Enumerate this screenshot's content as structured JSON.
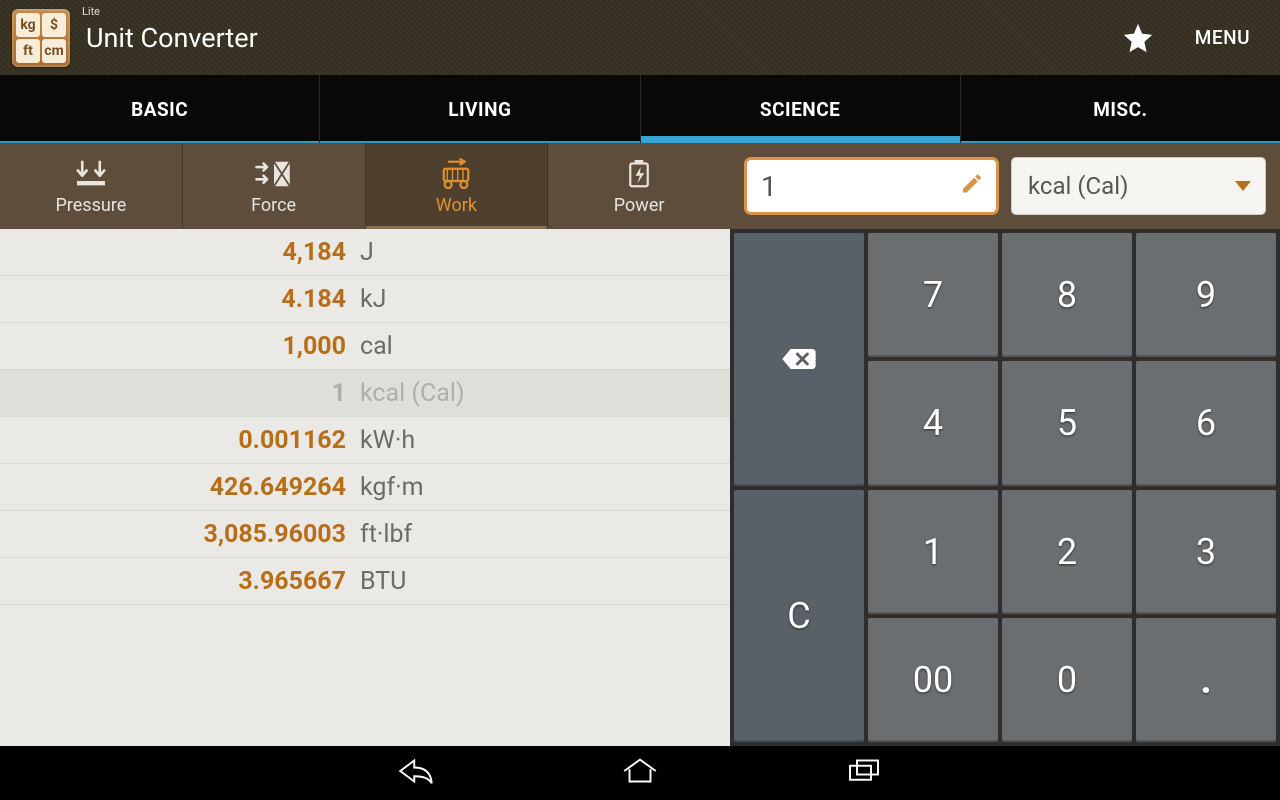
{
  "header": {
    "lite_badge": "Lite",
    "icon_tiles": [
      "kg",
      "$",
      "ft",
      "cm"
    ],
    "title": "Unit Converter",
    "menu_label": "MENU"
  },
  "tabs": [
    {
      "label": "BASIC",
      "active": false
    },
    {
      "label": "LIVING",
      "active": false
    },
    {
      "label": "SCIENCE",
      "active": true
    },
    {
      "label": "MISC.",
      "active": false
    }
  ],
  "categories": [
    {
      "name": "Pressure",
      "active": false
    },
    {
      "name": "Force",
      "active": false
    },
    {
      "name": "Work",
      "active": true
    },
    {
      "name": "Power",
      "active": false
    }
  ],
  "input": {
    "value": "1",
    "unit_selected": "kcal (Cal)"
  },
  "results": [
    {
      "value": "4,184",
      "unit": "J",
      "selected": false
    },
    {
      "value": "4.184",
      "unit": "kJ",
      "selected": false
    },
    {
      "value": "1,000",
      "unit": "cal",
      "selected": false
    },
    {
      "value": "1",
      "unit": "kcal (Cal)",
      "selected": true
    },
    {
      "value": "0.001162",
      "unit": "kW·h",
      "selected": false
    },
    {
      "value": "426.649264",
      "unit": "kgf·m",
      "selected": false
    },
    {
      "value": "3,085.96003",
      "unit": "ft·lbf",
      "selected": false
    },
    {
      "value": "3.965667",
      "unit": "BTU",
      "selected": false
    }
  ],
  "keypad": {
    "k7": "7",
    "k8": "8",
    "k9": "9",
    "k4": "4",
    "k5": "5",
    "k6": "6",
    "k1": "1",
    "k2": "2",
    "k3": "3",
    "k00": "00",
    "k0": "0",
    "kdot": ".",
    "clear": "C"
  },
  "colors": {
    "accent_orange": "#d8954a",
    "tab_indicator": "#34a7d8",
    "value_text": "#b86e19"
  }
}
